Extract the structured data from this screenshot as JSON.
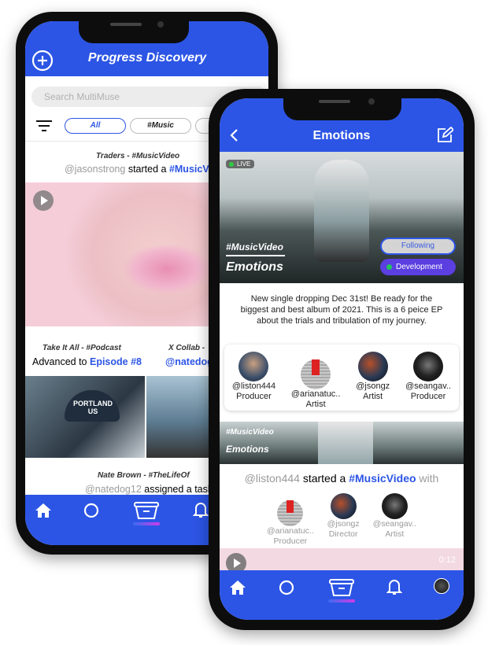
{
  "back_phone": {
    "header": {
      "title": "Progress Discovery",
      "add_icon": "plus-circle-icon"
    },
    "search": {
      "placeholder": "Search MultiMuse"
    },
    "filters": [
      "All",
      "#Music",
      ""
    ],
    "feed": [
      {
        "title": "Traders - #MusicVideo",
        "user": "@jasonstrong",
        "action": "started a",
        "tag": "#MusicVi"
      },
      {
        "title": "Take It All - #Podcast",
        "action": "Advanced to",
        "tag": "Episode #8"
      },
      {
        "title": "X Collab -",
        "user": "@natedog"
      },
      {
        "title": "Nate Brown - #TheLifeOf",
        "user": "@natedog12",
        "action": "assigned a task"
      }
    ],
    "cap_text": "PORTLAND US",
    "nav": [
      "home-icon",
      "circle-icon",
      "projects-tray-icon",
      "bell-icon"
    ]
  },
  "front_phone": {
    "header": {
      "title": "Emotions",
      "back_icon": "chevron-left-icon",
      "edit_icon": "edit-icon"
    },
    "hero": {
      "live": "LIVE",
      "tag": "#MusicVideo",
      "title": "Emotions",
      "following": "Following",
      "status": "Development",
      "status_color": "#22c55e"
    },
    "description": "New single dropping Dec 31st! Be ready for the biggest and best album of 2021. This is a 6 peice EP about the trials and tribulation of my journey.",
    "collaborators": [
      {
        "handle": "@liston444",
        "role": "Producer"
      },
      {
        "handle": "@arianatuc..",
        "role": "Artist"
      },
      {
        "handle": "@jsongz",
        "role": "Artist"
      },
      {
        "handle": "@seangav..",
        "role": "Producer"
      }
    ],
    "activity": {
      "tag": "#MusicVideo",
      "title": "Emotions",
      "user": "@liston444",
      "action": "started a",
      "project": "#MusicVideo",
      "suffix": "with",
      "members": [
        {
          "handle": "@arianatuc..",
          "role": "Producer"
        },
        {
          "handle": "@jsongz",
          "role": "Director"
        },
        {
          "handle": "@seangav..",
          "role": "Artist"
        }
      ],
      "duration": "0:12"
    },
    "nav": [
      "home-icon",
      "circle-icon",
      "projects-tray-icon",
      "bell-icon",
      "profile-avatar"
    ]
  },
  "colors": {
    "brand": "#2c55e5",
    "accent_purple": "#5b3fe0"
  }
}
